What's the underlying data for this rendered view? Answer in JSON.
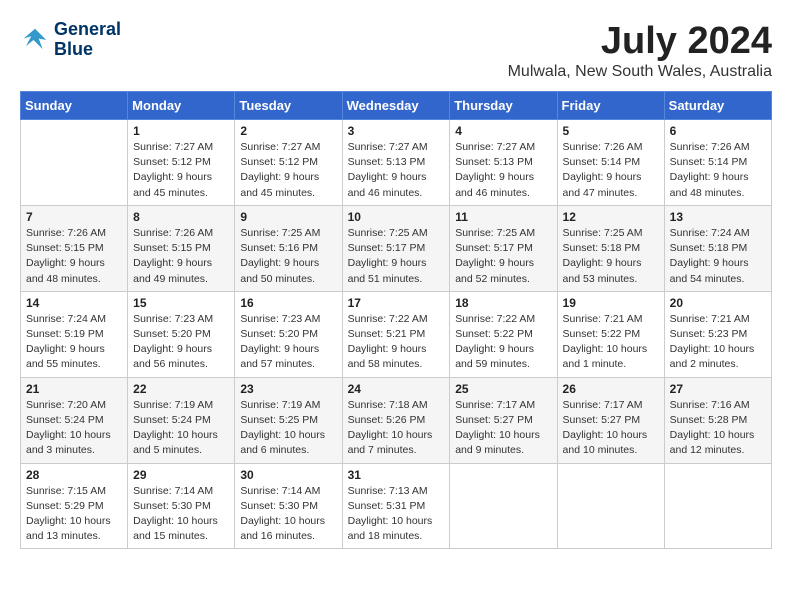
{
  "header": {
    "logo_line1": "General",
    "logo_line2": "Blue",
    "month": "July 2024",
    "location": "Mulwala, New South Wales, Australia"
  },
  "days_of_week": [
    "Sunday",
    "Monday",
    "Tuesday",
    "Wednesday",
    "Thursday",
    "Friday",
    "Saturday"
  ],
  "weeks": [
    [
      {
        "day": "",
        "sunrise": "",
        "sunset": "",
        "daylight": ""
      },
      {
        "day": "1",
        "sunrise": "Sunrise: 7:27 AM",
        "sunset": "Sunset: 5:12 PM",
        "daylight": "Daylight: 9 hours and 45 minutes."
      },
      {
        "day": "2",
        "sunrise": "Sunrise: 7:27 AM",
        "sunset": "Sunset: 5:12 PM",
        "daylight": "Daylight: 9 hours and 45 minutes."
      },
      {
        "day": "3",
        "sunrise": "Sunrise: 7:27 AM",
        "sunset": "Sunset: 5:13 PM",
        "daylight": "Daylight: 9 hours and 46 minutes."
      },
      {
        "day": "4",
        "sunrise": "Sunrise: 7:27 AM",
        "sunset": "Sunset: 5:13 PM",
        "daylight": "Daylight: 9 hours and 46 minutes."
      },
      {
        "day": "5",
        "sunrise": "Sunrise: 7:26 AM",
        "sunset": "Sunset: 5:14 PM",
        "daylight": "Daylight: 9 hours and 47 minutes."
      },
      {
        "day": "6",
        "sunrise": "Sunrise: 7:26 AM",
        "sunset": "Sunset: 5:14 PM",
        "daylight": "Daylight: 9 hours and 48 minutes."
      }
    ],
    [
      {
        "day": "7",
        "sunrise": "Sunrise: 7:26 AM",
        "sunset": "Sunset: 5:15 PM",
        "daylight": "Daylight: 9 hours and 48 minutes."
      },
      {
        "day": "8",
        "sunrise": "Sunrise: 7:26 AM",
        "sunset": "Sunset: 5:15 PM",
        "daylight": "Daylight: 9 hours and 49 minutes."
      },
      {
        "day": "9",
        "sunrise": "Sunrise: 7:25 AM",
        "sunset": "Sunset: 5:16 PM",
        "daylight": "Daylight: 9 hours and 50 minutes."
      },
      {
        "day": "10",
        "sunrise": "Sunrise: 7:25 AM",
        "sunset": "Sunset: 5:17 PM",
        "daylight": "Daylight: 9 hours and 51 minutes."
      },
      {
        "day": "11",
        "sunrise": "Sunrise: 7:25 AM",
        "sunset": "Sunset: 5:17 PM",
        "daylight": "Daylight: 9 hours and 52 minutes."
      },
      {
        "day": "12",
        "sunrise": "Sunrise: 7:25 AM",
        "sunset": "Sunset: 5:18 PM",
        "daylight": "Daylight: 9 hours and 53 minutes."
      },
      {
        "day": "13",
        "sunrise": "Sunrise: 7:24 AM",
        "sunset": "Sunset: 5:18 PM",
        "daylight": "Daylight: 9 hours and 54 minutes."
      }
    ],
    [
      {
        "day": "14",
        "sunrise": "Sunrise: 7:24 AM",
        "sunset": "Sunset: 5:19 PM",
        "daylight": "Daylight: 9 hours and 55 minutes."
      },
      {
        "day": "15",
        "sunrise": "Sunrise: 7:23 AM",
        "sunset": "Sunset: 5:20 PM",
        "daylight": "Daylight: 9 hours and 56 minutes."
      },
      {
        "day": "16",
        "sunrise": "Sunrise: 7:23 AM",
        "sunset": "Sunset: 5:20 PM",
        "daylight": "Daylight: 9 hours and 57 minutes."
      },
      {
        "day": "17",
        "sunrise": "Sunrise: 7:22 AM",
        "sunset": "Sunset: 5:21 PM",
        "daylight": "Daylight: 9 hours and 58 minutes."
      },
      {
        "day": "18",
        "sunrise": "Sunrise: 7:22 AM",
        "sunset": "Sunset: 5:22 PM",
        "daylight": "Daylight: 9 hours and 59 minutes."
      },
      {
        "day": "19",
        "sunrise": "Sunrise: 7:21 AM",
        "sunset": "Sunset: 5:22 PM",
        "daylight": "Daylight: 10 hours and 1 minute."
      },
      {
        "day": "20",
        "sunrise": "Sunrise: 7:21 AM",
        "sunset": "Sunset: 5:23 PM",
        "daylight": "Daylight: 10 hours and 2 minutes."
      }
    ],
    [
      {
        "day": "21",
        "sunrise": "Sunrise: 7:20 AM",
        "sunset": "Sunset: 5:24 PM",
        "daylight": "Daylight: 10 hours and 3 minutes."
      },
      {
        "day": "22",
        "sunrise": "Sunrise: 7:19 AM",
        "sunset": "Sunset: 5:24 PM",
        "daylight": "Daylight: 10 hours and 5 minutes."
      },
      {
        "day": "23",
        "sunrise": "Sunrise: 7:19 AM",
        "sunset": "Sunset: 5:25 PM",
        "daylight": "Daylight: 10 hours and 6 minutes."
      },
      {
        "day": "24",
        "sunrise": "Sunrise: 7:18 AM",
        "sunset": "Sunset: 5:26 PM",
        "daylight": "Daylight: 10 hours and 7 minutes."
      },
      {
        "day": "25",
        "sunrise": "Sunrise: 7:17 AM",
        "sunset": "Sunset: 5:27 PM",
        "daylight": "Daylight: 10 hours and 9 minutes."
      },
      {
        "day": "26",
        "sunrise": "Sunrise: 7:17 AM",
        "sunset": "Sunset: 5:27 PM",
        "daylight": "Daylight: 10 hours and 10 minutes."
      },
      {
        "day": "27",
        "sunrise": "Sunrise: 7:16 AM",
        "sunset": "Sunset: 5:28 PM",
        "daylight": "Daylight: 10 hours and 12 minutes."
      }
    ],
    [
      {
        "day": "28",
        "sunrise": "Sunrise: 7:15 AM",
        "sunset": "Sunset: 5:29 PM",
        "daylight": "Daylight: 10 hours and 13 minutes."
      },
      {
        "day": "29",
        "sunrise": "Sunrise: 7:14 AM",
        "sunset": "Sunset: 5:30 PM",
        "daylight": "Daylight: 10 hours and 15 minutes."
      },
      {
        "day": "30",
        "sunrise": "Sunrise: 7:14 AM",
        "sunset": "Sunset: 5:30 PM",
        "daylight": "Daylight: 10 hours and 16 minutes."
      },
      {
        "day": "31",
        "sunrise": "Sunrise: 7:13 AM",
        "sunset": "Sunset: 5:31 PM",
        "daylight": "Daylight: 10 hours and 18 minutes."
      },
      {
        "day": "",
        "sunrise": "",
        "sunset": "",
        "daylight": ""
      },
      {
        "day": "",
        "sunrise": "",
        "sunset": "",
        "daylight": ""
      },
      {
        "day": "",
        "sunrise": "",
        "sunset": "",
        "daylight": ""
      }
    ]
  ]
}
